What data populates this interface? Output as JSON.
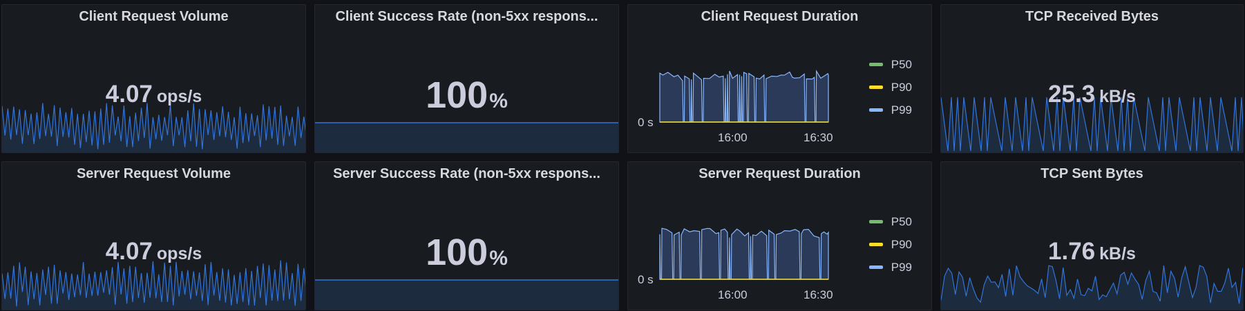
{
  "colors": {
    "background": "#111217",
    "panel": "#181b1f",
    "spark_line": "#3274d9",
    "spark_fill": "#1c2b3d",
    "p50": "#73bf69",
    "p90": "#fade2a",
    "p99": "#8ab8ff",
    "text": "#ccccdc"
  },
  "panels": {
    "client_volume": {
      "title": "Client Request Volume",
      "value": "4.07",
      "unit": "ops/s",
      "icon": "sparkline"
    },
    "client_success": {
      "title": "Client Success Rate (non-5xx respons...",
      "value": "100",
      "unit": "%",
      "icon": "sparkline"
    },
    "client_duration": {
      "title": "Client Request Duration",
      "y_label": "0 s",
      "x_ticks": [
        "16:00",
        "16:30"
      ],
      "legend": [
        {
          "name": "P50",
          "color": "#73bf69"
        },
        {
          "name": "P90",
          "color": "#fade2a"
        },
        {
          "name": "P99",
          "color": "#8ab8ff"
        }
      ]
    },
    "tcp_received": {
      "title": "TCP Received Bytes",
      "value": "25.3",
      "unit": "kB/s",
      "icon": "sparkline"
    },
    "server_volume": {
      "title": "Server Request Volume",
      "value": "4.07",
      "unit": "ops/s",
      "icon": "sparkline"
    },
    "server_success": {
      "title": "Server Success Rate (non-5xx respons...",
      "value": "100",
      "unit": "%",
      "icon": "sparkline"
    },
    "server_duration": {
      "title": "Server Request Duration",
      "y_label": "0 s",
      "x_ticks": [
        "16:00",
        "16:30"
      ],
      "legend": [
        {
          "name": "P50",
          "color": "#73bf69"
        },
        {
          "name": "P90",
          "color": "#fade2a"
        },
        {
          "name": "P99",
          "color": "#8ab8ff"
        }
      ]
    },
    "tcp_sent": {
      "title": "TCP Sent Bytes",
      "value": "1.76",
      "unit": "kB/s",
      "icon": "sparkline"
    }
  }
}
